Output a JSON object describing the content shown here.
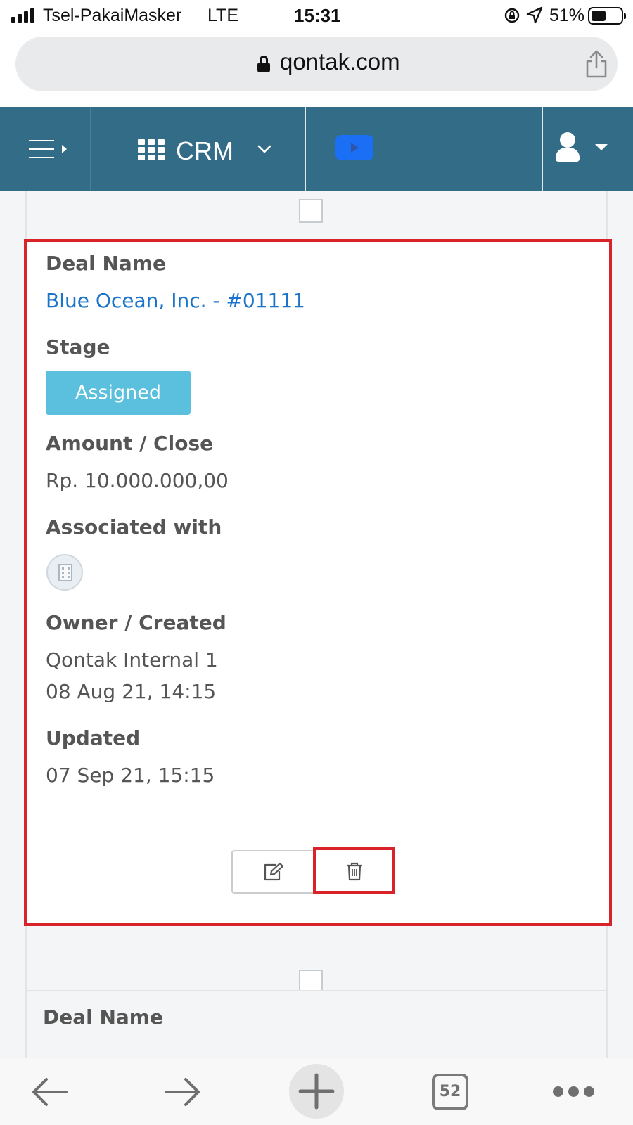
{
  "status_bar": {
    "carrier": "Tsel-PakaiMasker",
    "network": "LTE",
    "time": "15:31",
    "battery_percent": "51%",
    "battery_level": 0.51,
    "icons": [
      "signal-icon",
      "rotation-lock-icon",
      "location-arrow-icon",
      "battery-icon"
    ]
  },
  "browser": {
    "domain": "qontak.com",
    "tab_count": "52",
    "icons": [
      "padlock-icon",
      "share-icon",
      "back-arrow-icon",
      "forward-arrow-icon",
      "plus-icon",
      "tabs-icon",
      "more-icon"
    ]
  },
  "nav": {
    "module_label": "CRM",
    "background": "#336c87",
    "video_button_color": "#1a6ff5",
    "icons": [
      "hamburger-menu-icon",
      "apps-grid-icon",
      "chevron-down-icon",
      "video-play-icon",
      "user-icon",
      "caret-down-icon"
    ]
  },
  "deal": {
    "deal_name_label": "Deal Name",
    "deal_name": "Blue Ocean, Inc. - #01111",
    "stage_label": "Stage",
    "stage": "Assigned",
    "stage_color": "#5bc0de",
    "amount_label": "Amount / Close",
    "amount": "Rp. 10.000.000,00",
    "associated_label": "Associated with",
    "associated_icon": "building-icon",
    "owner_label": "Owner / Created",
    "owner": "Qontak Internal 1",
    "created": "08 Aug 21, 14:15",
    "updated_label": "Updated",
    "updated": "07 Sep 21, 15:15",
    "actions": [
      "edit-icon",
      "trash-icon"
    ],
    "highlight_color": "#d8232a",
    "link_color": "#1b74c9"
  },
  "next_deal": {
    "deal_name_label": "Deal Name"
  }
}
